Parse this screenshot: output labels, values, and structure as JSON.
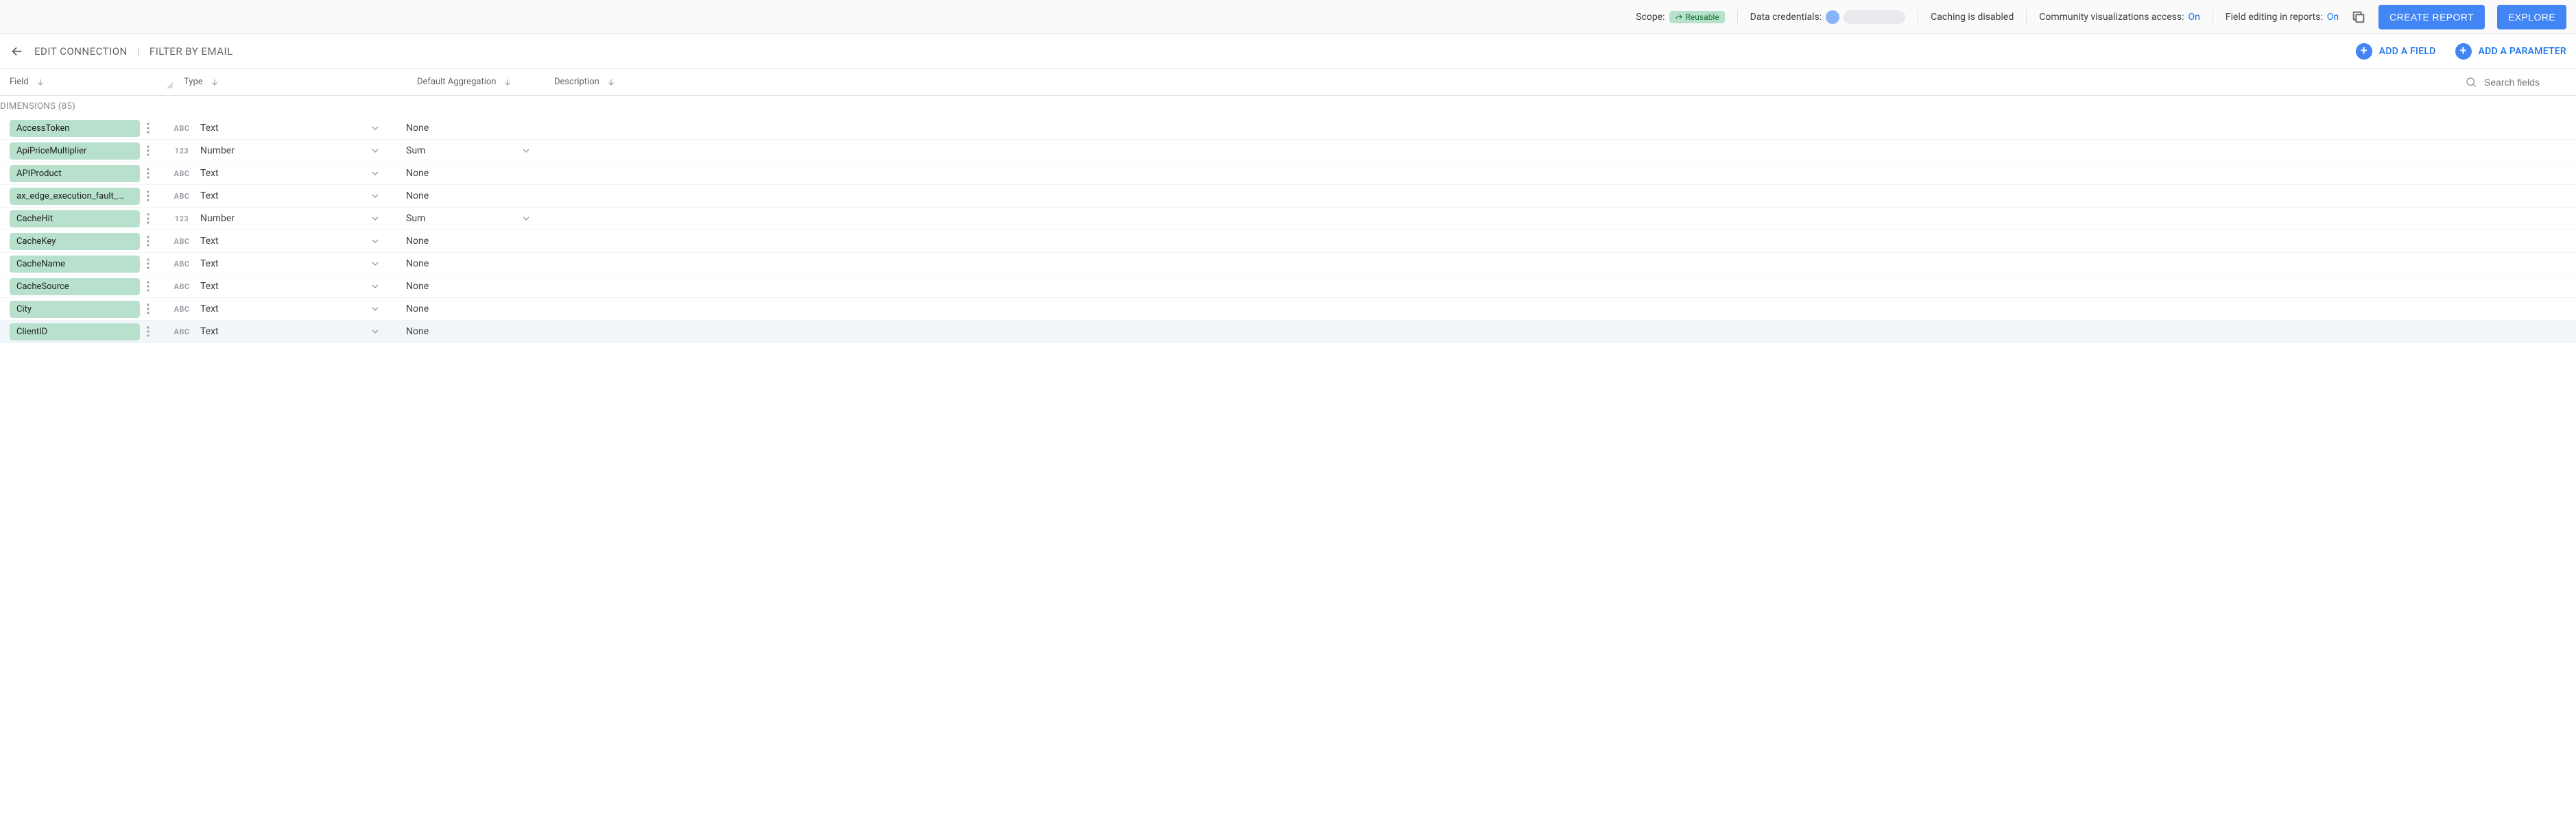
{
  "topbar": {
    "scope_label": "Scope:",
    "reusable": "Reusable",
    "data_credentials_label": "Data credentials:",
    "caching": "Caching is disabled",
    "community_vis_label": "Community visualizations access:",
    "community_vis_state": "On",
    "field_editing_label": "Field editing in reports:",
    "field_editing_state": "On",
    "create_report": "CREATE REPORT",
    "explore": "EXPLORE"
  },
  "subheader": {
    "edit_connection": "EDIT CONNECTION",
    "filter_by_email": "FILTER BY EMAIL",
    "add_field": "ADD A FIELD",
    "add_parameter": "ADD A PARAMETER"
  },
  "columns": {
    "field": "Field",
    "type": "Type",
    "aggregation": "Default Aggregation",
    "description": "Description",
    "search_placeholder": "Search fields"
  },
  "section": {
    "dimensions_label": "DIMENSIONS",
    "dimensions_count": 85
  },
  "rows": [
    {
      "name": "AccessToken",
      "type_icon": "ABC",
      "type": "Text",
      "aggregation": "None",
      "agg_dropdown": false
    },
    {
      "name": "ApiPriceMultiplier",
      "type_icon": "123",
      "type": "Number",
      "aggregation": "Sum",
      "agg_dropdown": true
    },
    {
      "name": "APIProduct",
      "type_icon": "ABC",
      "type": "Text",
      "aggregation": "None",
      "agg_dropdown": false
    },
    {
      "name": "ax_edge_execution_fault_…",
      "type_icon": "ABC",
      "type": "Text",
      "aggregation": "None",
      "agg_dropdown": false
    },
    {
      "name": "CacheHit",
      "type_icon": "123",
      "type": "Number",
      "aggregation": "Sum",
      "agg_dropdown": true
    },
    {
      "name": "CacheKey",
      "type_icon": "ABC",
      "type": "Text",
      "aggregation": "None",
      "agg_dropdown": false
    },
    {
      "name": "CacheName",
      "type_icon": "ABC",
      "type": "Text",
      "aggregation": "None",
      "agg_dropdown": false
    },
    {
      "name": "CacheSource",
      "type_icon": "ABC",
      "type": "Text",
      "aggregation": "None",
      "agg_dropdown": false
    },
    {
      "name": "City",
      "type_icon": "ABC",
      "type": "Text",
      "aggregation": "None",
      "agg_dropdown": false
    },
    {
      "name": "ClientID",
      "type_icon": "ABC",
      "type": "Text",
      "aggregation": "None",
      "agg_dropdown": false
    }
  ]
}
